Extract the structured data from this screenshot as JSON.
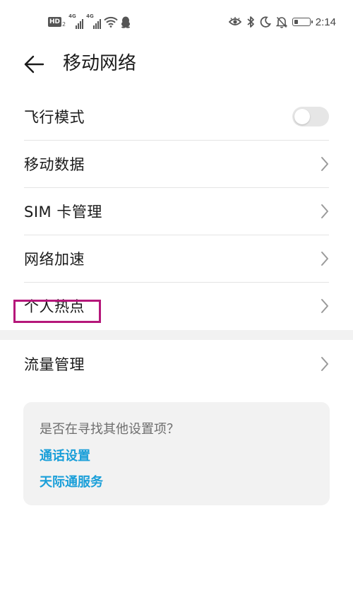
{
  "status_bar": {
    "hd_label": "HD",
    "hd_sub": "2",
    "sim1_type": "4G",
    "sim2_type": "4G",
    "battery_level": 0.25,
    "time": "2:14",
    "left_icons": [
      "hd-voice-icon",
      "signal-icon",
      "signal-icon",
      "wifi-icon",
      "qq-icon"
    ],
    "right_icons": [
      "eye-comfort-icon",
      "bluetooth-icon",
      "moon-icon",
      "mute-bell-icon",
      "battery-icon"
    ]
  },
  "header": {
    "back_icon": "arrow-left-icon",
    "title": "移动网络"
  },
  "settings": {
    "items": [
      {
        "label": "飞行模式",
        "control": "toggle",
        "toggle_on": false
      },
      {
        "label": "移动数据",
        "control": "chevron"
      },
      {
        "label": "SIM 卡管理",
        "control": "chevron"
      },
      {
        "label": "网络加速",
        "control": "chevron"
      },
      {
        "label": "个人热点",
        "control": "chevron",
        "highlighted": true
      }
    ],
    "items2": [
      {
        "label": "流量管理",
        "control": "chevron"
      }
    ]
  },
  "card": {
    "question": "是否在寻找其他设置项？",
    "links": [
      "通话设置",
      "天际通服务"
    ]
  },
  "colors": {
    "link": "#1a9fd9",
    "highlight_border": "#b5177a",
    "divider_band": "#f2f2f2",
    "card_bg": "#f2f2f2"
  }
}
